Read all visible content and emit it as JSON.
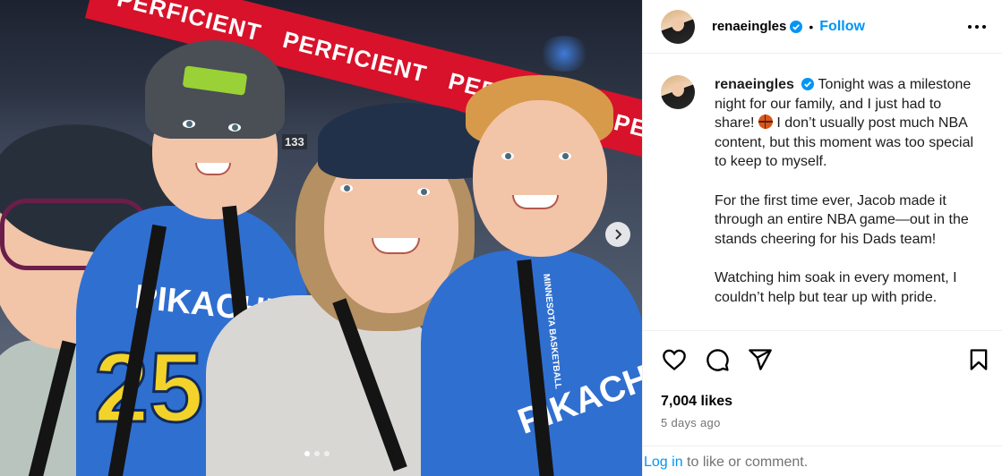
{
  "post": {
    "username": "renaeingles",
    "follow_label": "Follow",
    "bullet": "•",
    "caption_paragraphs": [
      "Tonight was a milestone night for our family, and I just had to share!",
      "I don’t usually post much NBA content, but this moment was too special to keep to myself.",
      "For the first time ever, Jacob made it through an entire NBA game—out in the stands cheering for his Dads team!",
      "Watching him soak in every moment, I couldn’t help but tear up with pride."
    ],
    "likes": "7,004 likes",
    "time_ago": "5 days ago",
    "login_link": "Log in",
    "login_suffix": " to like or comment."
  },
  "photo": {
    "banner_text": [
      "PERFICIENT",
      "PERFICIENT",
      "PERFICIENT",
      "PERFICIENT"
    ],
    "jersey_name": "PIKACHU",
    "jersey_number": "25",
    "lanyard_text": "MINNESOTA BASKETBALL",
    "seat_number": "133",
    "carousel_total": 3,
    "carousel_active": 1
  },
  "icons": {
    "verified": "verified-badge-icon",
    "more": "more-horizontal-icon",
    "like": "heart-icon",
    "comment": "comment-bubble-icon",
    "share": "send-arrow-icon",
    "save": "bookmark-icon",
    "next": "chevron-right-icon",
    "emoji": "basketball-emoji-icon"
  },
  "colors": {
    "link_blue": "#0095f6",
    "verified_blue": "#0095f6",
    "muted_text": "#737373",
    "banner_red": "#d8122a",
    "jersey_blue": "#2f6fd0",
    "jersey_yellow": "#f3d22a"
  }
}
